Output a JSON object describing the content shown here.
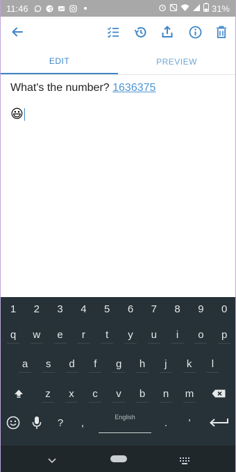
{
  "status_bar": {
    "time": "11:46",
    "battery": "31%",
    "left_icons": [
      "whatsapp-icon",
      "telegram-icon",
      "gallery-icon",
      "instagram-icon",
      "dot-icon"
    ],
    "right_icons": [
      "alarm-icon",
      "no-sim-icon",
      "wifi-icon",
      "signal-icon",
      "battery-icon"
    ]
  },
  "toolbar": {
    "icons": [
      "back-arrow-icon",
      "checklist-icon",
      "history-icon",
      "share-icon",
      "info-icon",
      "delete-icon"
    ]
  },
  "tabs": [
    {
      "label": "EDIT",
      "active": true
    },
    {
      "label": "PREVIEW",
      "active": false
    }
  ],
  "editor": {
    "text": "What's the number? ",
    "link": "1636375",
    "emoji": "😃"
  },
  "keyboard": {
    "numbers": [
      "1",
      "2",
      "3",
      "4",
      "5",
      "6",
      "7",
      "8",
      "9",
      "0"
    ],
    "row1": [
      "q",
      "w",
      "e",
      "r",
      "t",
      "y",
      "u",
      "i",
      "o",
      "p"
    ],
    "row2": [
      "a",
      "s",
      "d",
      "f",
      "g",
      "h",
      "j",
      "k",
      "l"
    ],
    "row3": [
      "z",
      "x",
      "c",
      "v",
      "b",
      "n",
      "m"
    ],
    "bottom": {
      "question": "?",
      "comma": ",",
      "space_label": "English",
      "period": ".",
      "apostrophe": "'"
    }
  },
  "colors": {
    "accent": "#3f86c6",
    "keyboard_bg": "#263238",
    "status_bg": "#a8a8a8"
  }
}
